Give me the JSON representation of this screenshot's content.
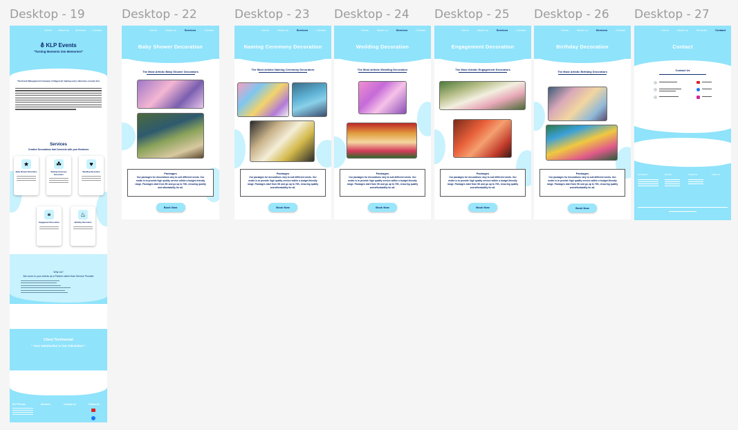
{
  "frames": {
    "f19": "Desktop - 19",
    "f22": "Desktop - 22",
    "f23": "Desktop - 23",
    "f24": "Desktop - 24",
    "f25": "Desktop - 25",
    "f26": "Desktop - 26",
    "f27": "Desktop - 27"
  },
  "nav": {
    "home": "Home",
    "about": "About us",
    "services": "Services",
    "contact": "Contact"
  },
  "home": {
    "brand": "KLP Events",
    "tagline": "\"Turning Moments into Memories!\"",
    "heading": "The Event Management Company in Nagercoil making every milestone a lovely fest",
    "services_title": "Services",
    "services_sub": "Creative Decorations that Connects with your Emotions",
    "cards": [
      "Baby Shower Decoration",
      "Naming Ceremony Decoration",
      "Wedding Decoration",
      "Engagement Decoration",
      "Birthday Decoration"
    ],
    "why_title": "Why Us?",
    "why_line": "We come to your events as a Partner rather than Service Provider",
    "testimonial_title": "Client Testimonial",
    "testimonial_quote": "\" Your Satisfaction is Our Felicitation \"",
    "footer_brand": "KLP Events",
    "footer_services": "Services",
    "footer_contact": "Contact us",
    "footer_follow": "Follow Us"
  },
  "pages": {
    "baby": {
      "title": "Baby Shower Decoration",
      "sub": "The Most Artistic Baby Shower Decorators"
    },
    "naming": {
      "title": "Naming Ceremony Decoration",
      "sub": "The Most Artistic Naming Ceremony Decorators"
    },
    "wedding": {
      "title": "Wedding Decoration",
      "sub": "The Most Artistic Wedding Decorators"
    },
    "engagement": {
      "title": "Engagement Decoration",
      "sub": "The Most Artistic Engagement Decorators"
    },
    "birthday": {
      "title": "Birthday  Decoration",
      "sub": "The Most Artistic Birthday Decorators"
    }
  },
  "packages": {
    "title": "Packages",
    "text": "Our packages for decorations vary to suit different needs. Our motto is to provide high quality service within a budget-friendly range. Packages start from 5K and go up to 70K, ensuring quality and affordability for all."
  },
  "book_label": "Book Now",
  "contact_page": {
    "title": "Contact",
    "sub": "Contact Us",
    "testimonial_title": "Client Testimonial",
    "testimonial_quote": "\" Your Satisfaction is Our Felicitation \""
  },
  "colors": {
    "sky": "#8fe3fb",
    "navy": "#0d2a6e",
    "canvas": "#f5f5f5"
  }
}
